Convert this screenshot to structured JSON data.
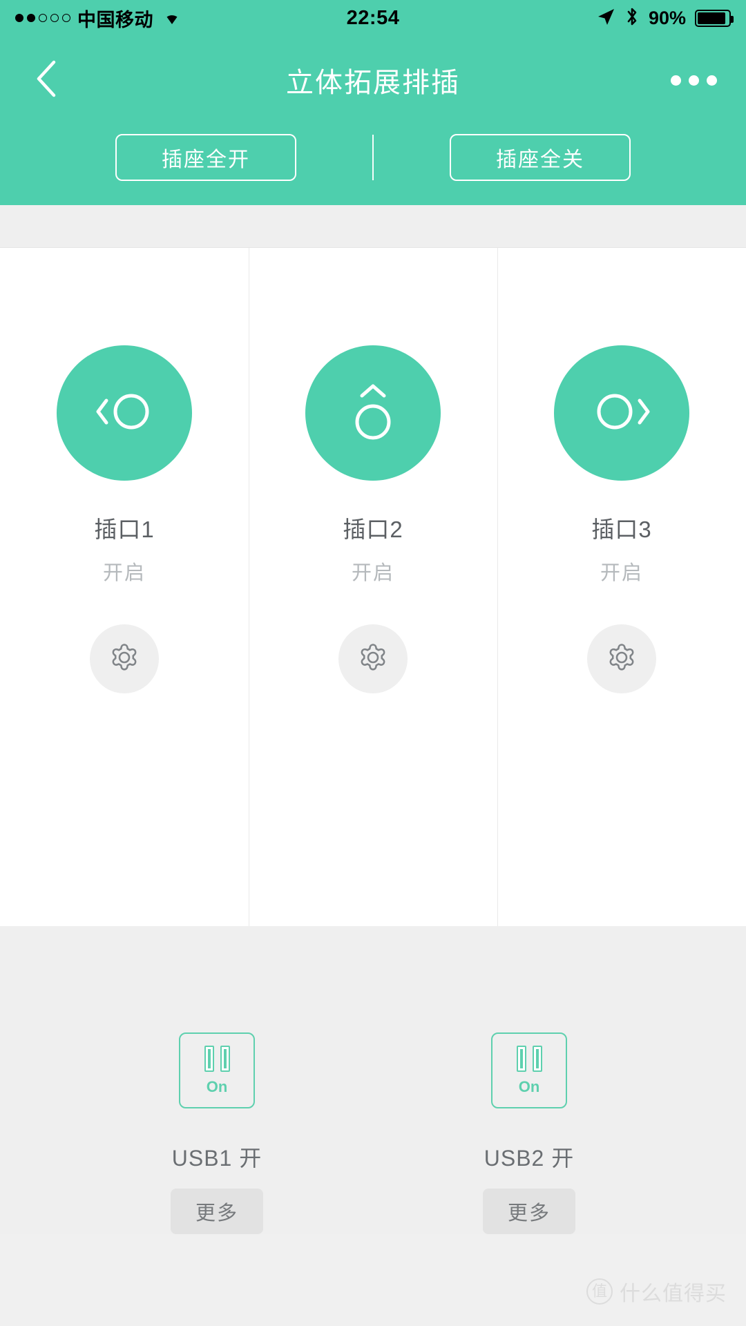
{
  "status_bar": {
    "signal_dots_filled": 2,
    "signal_dots_total": 5,
    "carrier": "中国移动",
    "wifi_icon": "wifi-icon",
    "time": "22:54",
    "location_icon": "location-arrow-icon",
    "bluetooth_icon": "bluetooth-icon",
    "battery_percent": "90%",
    "battery_icon": "battery-icon"
  },
  "header": {
    "back_icon": "chevron-left-icon",
    "title": "立体拓展排插",
    "more_icon": "more-dots-icon",
    "all_on_label": "插座全开",
    "all_off_label": "插座全关"
  },
  "sockets": [
    {
      "icon": "chevron-left-circle-icon",
      "name": "插口1",
      "state": "开启",
      "settings_icon": "gear-icon"
    },
    {
      "icon": "chevron-up-circle-icon",
      "name": "插口2",
      "state": "开启",
      "settings_icon": "gear-icon"
    },
    {
      "icon": "circle-chevron-right-icon",
      "name": "插口3",
      "state": "开启",
      "settings_icon": "gear-icon"
    }
  ],
  "usb_ports": [
    {
      "icon": "usb-bars-icon",
      "button_state": "On",
      "label": "USB1 开",
      "more_label": "更多"
    },
    {
      "icon": "usb-bars-icon",
      "button_state": "On",
      "label": "USB2 开",
      "more_label": "更多"
    }
  ],
  "watermark": {
    "logo_char": "值",
    "text": "什么值得买"
  },
  "colors": {
    "brand_green": "#4ecfad",
    "usb_green": "#5ed0ae",
    "page_bg": "#efefef",
    "panel_bg": "#ffffff",
    "label_gray": "#5b5f63",
    "muted_gray": "#b5b9bc"
  }
}
